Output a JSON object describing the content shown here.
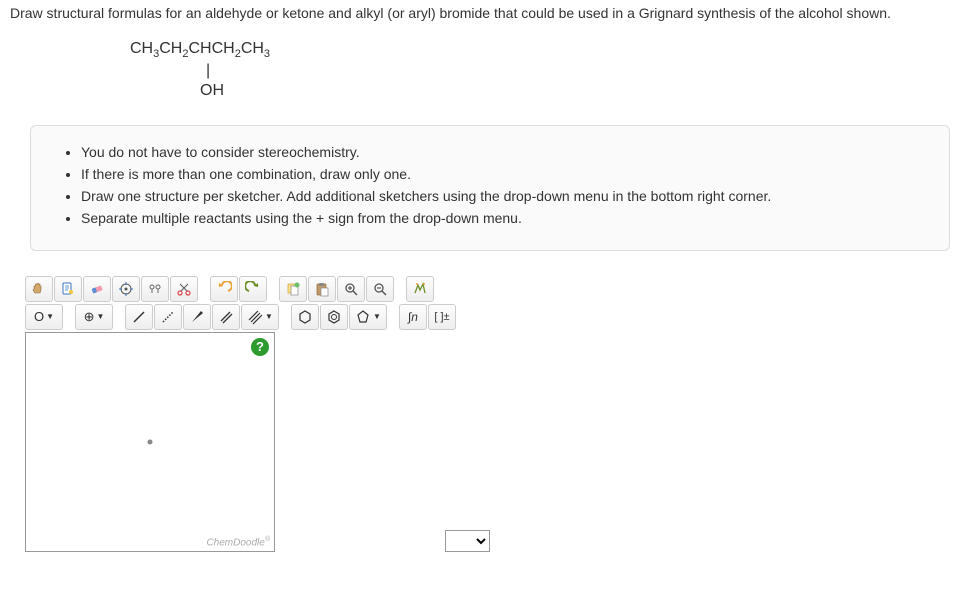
{
  "question": "Draw structural formulas for an aldehyde or ketone and alkyl (or aryl) bromide that could be used in a Grignard synthesis of the alcohol shown.",
  "formula": {
    "line1_html": "CH₃CH₂CHCH₂CH₃",
    "line2": "|",
    "line3": "OH"
  },
  "instructions": [
    "You do not have to consider stereochemistry.",
    "If there is more than one combination, draw only one.",
    "Draw one structure per sketcher. Add additional sketchers using the drop-down menu in the bottom right corner.",
    "Separate multiple reactants using the + sign from the drop-down menu."
  ],
  "toolbar": {
    "row1": [
      "hand",
      "lasso",
      "eraser",
      "center",
      "clean",
      "cut",
      "undo",
      "redo",
      "copy",
      "paste",
      "zoom-in",
      "zoom-out",
      "flip"
    ],
    "row2_left_label": "O",
    "row2_charge_label": "⊕",
    "brackets": "[ ]±",
    "script_n": "∫n"
  },
  "help": "?",
  "chemdoodle": "ChemDoodle",
  "select_options": [
    ""
  ]
}
